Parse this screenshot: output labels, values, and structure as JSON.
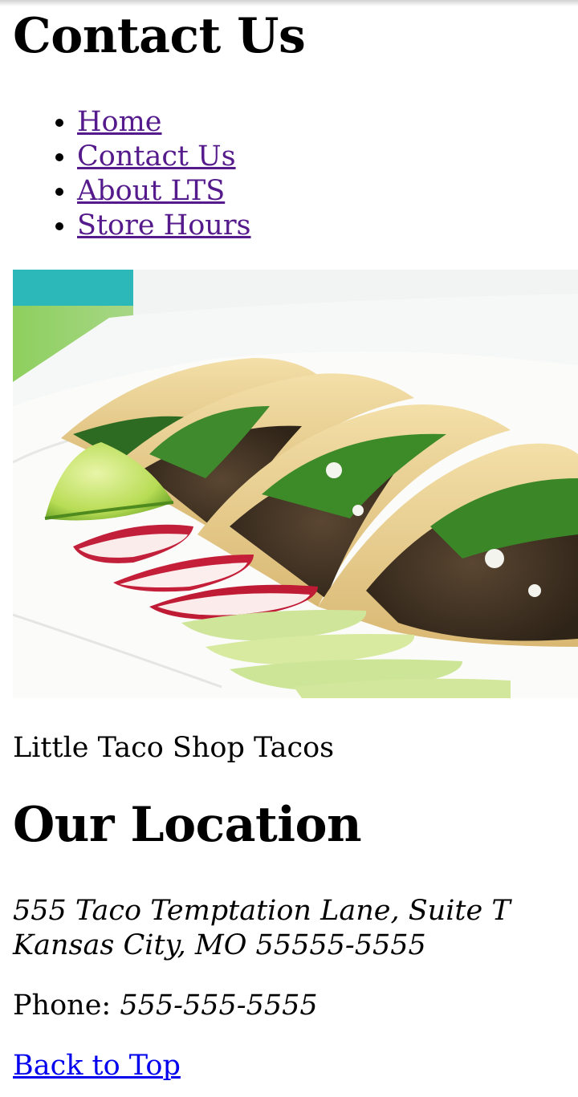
{
  "page": {
    "title": "Contact Us"
  },
  "nav": {
    "items": [
      {
        "label": "Home"
      },
      {
        "label": "Contact Us"
      },
      {
        "label": "About LTS"
      },
      {
        "label": "Store Hours"
      }
    ]
  },
  "photo": {
    "caption": "Little Taco Shop Tacos"
  },
  "location": {
    "heading": "Our Location",
    "address_line1": "555 Taco Temptation Lane, Suite T",
    "address_line2": "Kansas City, MO 55555-5555",
    "phone_label": "Phone:",
    "phone_number": "555-555-5555"
  },
  "footer": {
    "back_to_top": "Back to Top"
  },
  "colors": {
    "visited_link": "#551a8b",
    "link": "#0000ee"
  }
}
